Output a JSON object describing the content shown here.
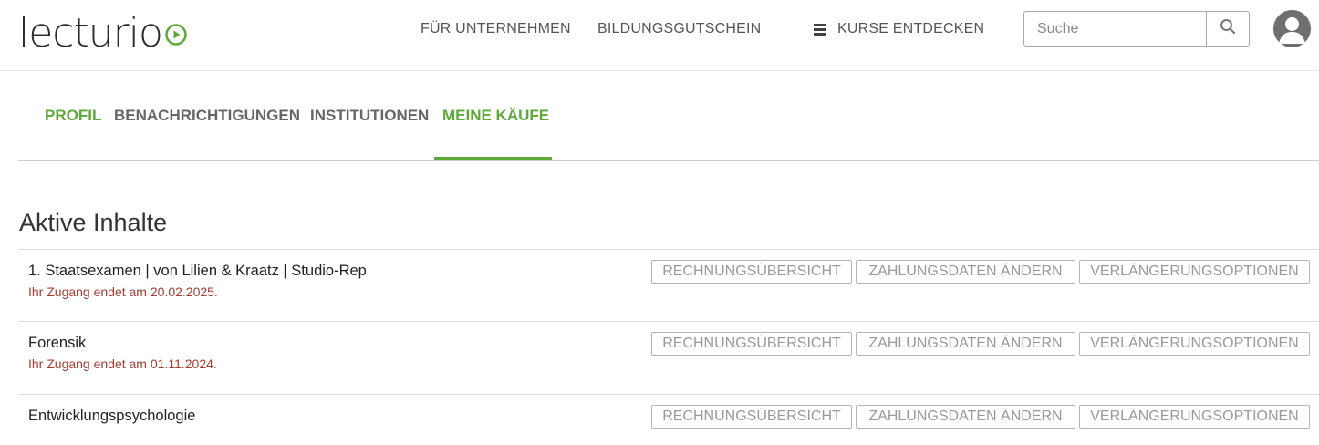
{
  "header": {
    "logo_text": "lecturio",
    "nav": {
      "unternehmen": "FÜR UNTERNEHMEN",
      "gutschein": "BILDUNGSGUTSCHEIN",
      "kurse": "KURSE ENTDECKEN"
    },
    "search": {
      "placeholder": "Suche",
      "value": ""
    },
    "icons": {
      "menu": "hamburger-icon",
      "search": "search-icon",
      "avatar": "user-avatar-icon"
    }
  },
  "tabs": [
    {
      "label": "PROFIL",
      "active": false
    },
    {
      "label": "BENACHRICHTIGUNGEN",
      "active": false
    },
    {
      "label": "INSTITUTIONEN",
      "active": false
    },
    {
      "label": "MEINE KÄUFE",
      "active": true
    }
  ],
  "main": {
    "section_title": "Aktive Inhalte",
    "purchases": [
      {
        "title": "1. Staatsexamen | von Lilien & Kraatz | Studio-Rep",
        "expiry": "Ihr Zugang endet am 20.02.2025.",
        "actions": [
          "RECHNUNGSÜBERSICHT",
          "ZAHLUNGSDATEN ÄNDERN",
          "VERLÄNGERUNGSOPTIONEN"
        ]
      },
      {
        "title": "Forensik",
        "expiry": "Ihr Zugang endet am 01.11.2024.",
        "actions": [
          "RECHNUNGSÜBERSICHT",
          "ZAHLUNGSDATEN ÄNDERN",
          "VERLÄNGERUNGSOPTIONEN"
        ]
      },
      {
        "title": "Entwicklungspsychologie",
        "expiry": "",
        "actions": [
          "RECHNUNGSÜBERSICHT",
          "ZAHLUNGSDATEN ÄNDERN",
          "VERLÄNGERUNGSOPTIONEN"
        ]
      }
    ]
  },
  "colors": {
    "brand_green": "#5fa83a",
    "expiry_red": "#a33d30",
    "text_dark": "#333333",
    "button_text": "#999999"
  }
}
